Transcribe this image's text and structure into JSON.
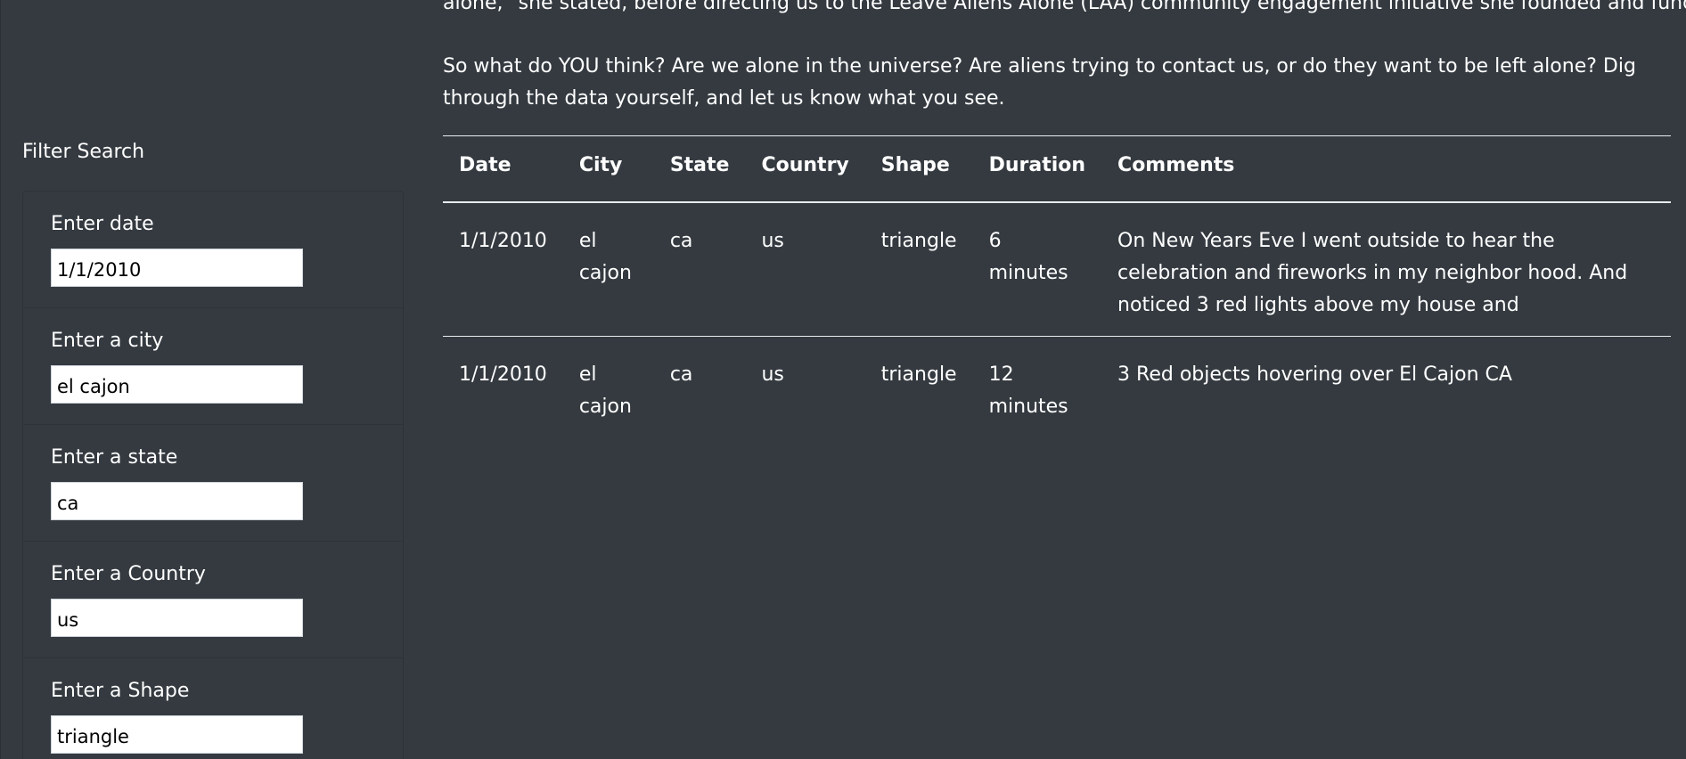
{
  "article": {
    "paragraph_top": "alone,\" she stated, before directing us to the Leave Aliens Alone (LAA) community engagement initiative she founded and funds.",
    "paragraph_2": "So what do YOU think? Are we alone in the universe? Are aliens trying to contact us, or do they want to be left alone? Dig through the data yourself, and let us know what you see."
  },
  "sidebar": {
    "title": "Filter Search",
    "filters": [
      {
        "label": "Enter date",
        "value": "1/1/2010"
      },
      {
        "label": "Enter a city",
        "value": "el cajon"
      },
      {
        "label": "Enter a state",
        "value": "ca"
      },
      {
        "label": "Enter a Country",
        "value": "us"
      },
      {
        "label": "Enter a Shape",
        "value": "triangle"
      }
    ]
  },
  "table": {
    "headers": [
      "Date",
      "City",
      "State",
      "Country",
      "Shape",
      "Duration",
      "Comments"
    ],
    "rows": [
      [
        "1/1/2010",
        "el cajon",
        "ca",
        "us",
        "triangle",
        "6 minutes",
        "On New Years Eve I went outside to hear the celebration and fireworks in my neighbor hood. And noticed 3 red lights above my house and"
      ],
      [
        "1/1/2010",
        "el cajon",
        "ca",
        "us",
        "triangle",
        "12 minutes",
        "3 Red objects hovering over El Cajon CA"
      ]
    ]
  },
  "colors": {
    "background": "#343a40",
    "text": "#ffffff",
    "rule": "#e9ecef"
  }
}
